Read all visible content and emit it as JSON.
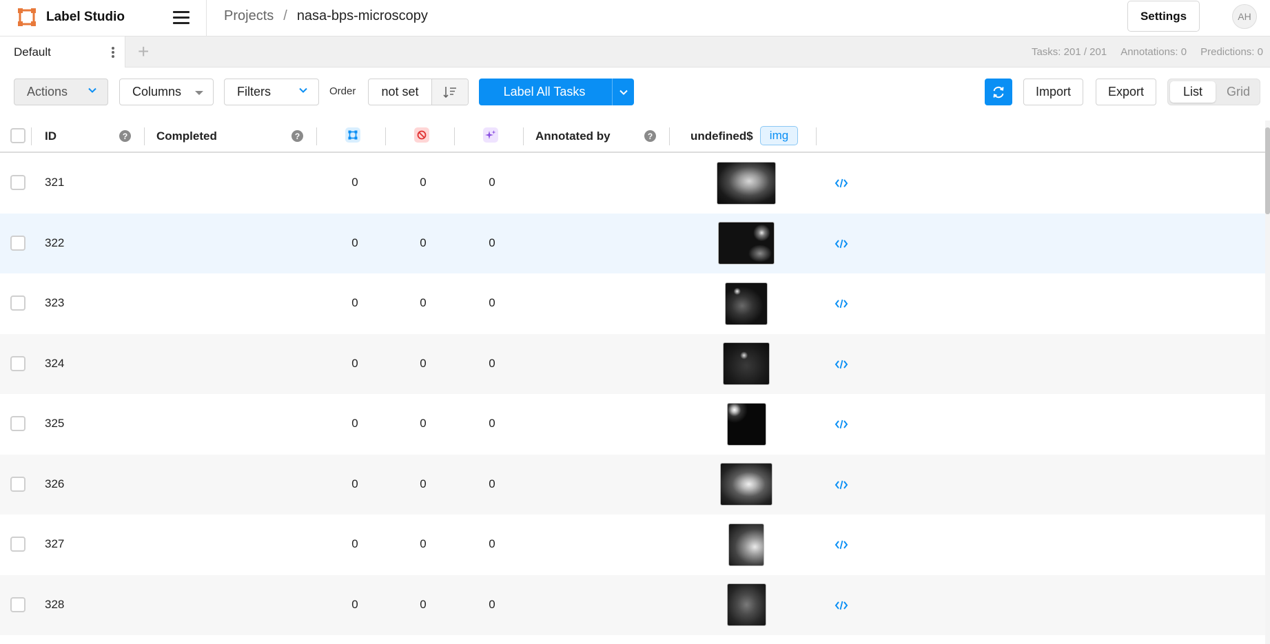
{
  "app": {
    "name": "Label Studio",
    "colors": {
      "brand_orange": "#e8793a",
      "accent_blue": "#0a8ff4"
    }
  },
  "breadcrumb": {
    "projects": "Projects",
    "separator": "/",
    "current": "nasa-bps-microscopy"
  },
  "header": {
    "settings_label": "Settings",
    "avatar_initials": "AH"
  },
  "tabs": {
    "items": [
      {
        "label": "Default",
        "active": true
      }
    ],
    "add_label": "+"
  },
  "stats": {
    "tasks": "Tasks: 201 / 201",
    "annotations": "Annotations: 0",
    "predictions": "Predictions: 0"
  },
  "toolbar": {
    "actions_label": "Actions",
    "columns_label": "Columns",
    "filters_label": "Filters",
    "order_label": "Order",
    "order_value": "not set",
    "label_all_label": "Label All Tasks",
    "import_label": "Import",
    "export_label": "Export",
    "view_list_label": "List",
    "view_grid_label": "Grid",
    "active_view": "List"
  },
  "table": {
    "columns": {
      "id": "ID",
      "completed": "Completed",
      "annotated_by": "Annotated by",
      "data_column": "undefined$",
      "data_chip": "img"
    },
    "header_icons": [
      "total-annotations-icon",
      "cancelled-annotations-icon",
      "predictions-icon"
    ],
    "rows": [
      {
        "id": "321",
        "total": "0",
        "cancelled": "0",
        "predictions": "0",
        "highlighted": false
      },
      {
        "id": "322",
        "total": "0",
        "cancelled": "0",
        "predictions": "0",
        "highlighted": true
      },
      {
        "id": "323",
        "total": "0",
        "cancelled": "0",
        "predictions": "0",
        "highlighted": false
      },
      {
        "id": "324",
        "total": "0",
        "cancelled": "0",
        "predictions": "0",
        "highlighted": false
      },
      {
        "id": "325",
        "total": "0",
        "cancelled": "0",
        "predictions": "0",
        "highlighted": false
      },
      {
        "id": "326",
        "total": "0",
        "cancelled": "0",
        "predictions": "0",
        "highlighted": false
      },
      {
        "id": "327",
        "total": "0",
        "cancelled": "0",
        "predictions": "0",
        "highlighted": false
      },
      {
        "id": "328",
        "total": "0",
        "cancelled": "0",
        "predictions": "0",
        "highlighted": false
      }
    ]
  }
}
